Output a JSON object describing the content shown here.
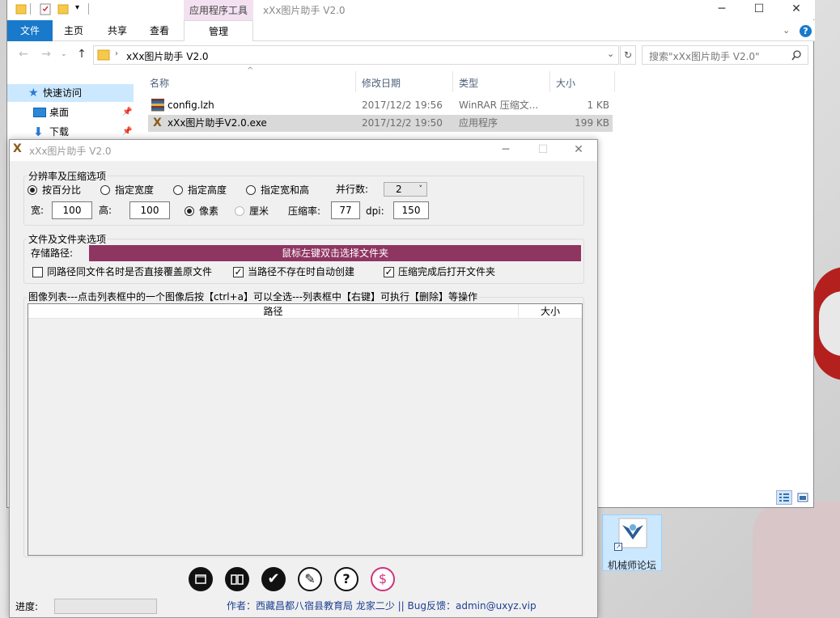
{
  "explorer": {
    "window_title": "xXx图片助手 V2.0",
    "context_tab_group": "应用程序工具",
    "tabs": {
      "file": "文件",
      "home": "主页",
      "share": "共享",
      "view": "查看",
      "manage": "管理"
    },
    "address_path": "xXx图片助手 V2.0",
    "search_placeholder": "搜索\"xXx图片助手 V2.0\"",
    "nav": {
      "quick_access": "快速访问",
      "desktop": "桌面",
      "downloads": "下载"
    },
    "columns": {
      "name": "名称",
      "date": "修改日期",
      "type": "类型",
      "size": "大小"
    },
    "files": [
      {
        "name": "config.lzh",
        "date": "2017/12/2 19:56",
        "type": "WinRAR 压缩文...",
        "size": "1 KB"
      },
      {
        "name": "xXx图片助手V2.0.exe",
        "date": "2017/12/2 19:50",
        "type": "应用程序",
        "size": "199 KB"
      }
    ]
  },
  "desktop": {
    "shortcut_label": "机械师论坛"
  },
  "app": {
    "title": "xXx图片助手 V2.0",
    "resolution_group": "分辨率及压缩选项",
    "radio_percent": "按百分比",
    "radio_width": "指定宽度",
    "radio_height": "指定高度",
    "radio_wh": "指定宽和高",
    "parallel_label": "并行数:",
    "parallel_value": "2",
    "width_label": "宽:",
    "width_value": "100",
    "height_label": "高:",
    "height_value": "100",
    "unit_pixel": "像素",
    "unit_cm": "厘米",
    "compress_label": "压缩率:",
    "compress_value": "77",
    "dpi_label": "dpi:",
    "dpi_value": "150",
    "file_group": "文件及文件夹选项",
    "save_path_label": "存储路径:",
    "save_path_hint": "鼠标左键双击选择文件夹",
    "chk_overwrite": "同路径同文件名时是否直接覆盖原文件",
    "chk_autocreate": "当路径不存在时自动创建",
    "chk_openfolder": "压缩完成后打开文件夹",
    "chk_overwrite_state": false,
    "chk_autocreate_state": true,
    "chk_openfolder_state": true,
    "list_hint": "图像列表---点击列表框中的一个图像后按【ctrl+a】可以全选---列表框中【右键】可执行【删除】等操作",
    "list_col_path": "路径",
    "list_col_size": "大小",
    "progress_label": "进度:",
    "progress_value": 0,
    "footer": "作者：西藏昌都八宿县教育局 龙家二少 || Bug反馈：admin@uxyz.vip"
  }
}
